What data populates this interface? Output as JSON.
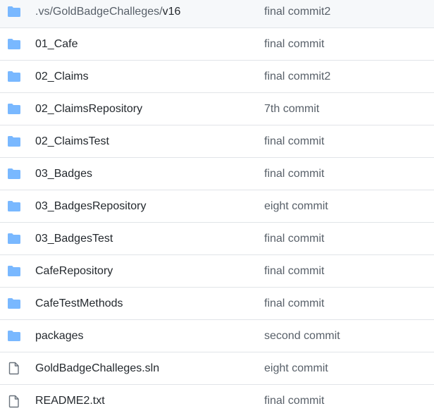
{
  "files": [
    {
      "name_prefix": ".vs/GoldBadgeChalleges/",
      "name": "v16",
      "commit": "final commit2",
      "icon": "folder-icon"
    },
    {
      "name_prefix": "",
      "name": "01_Cafe",
      "commit": "final commit",
      "icon": "folder-icon"
    },
    {
      "name_prefix": "",
      "name": "02_Claims",
      "commit": "final commit2",
      "icon": "folder-icon"
    },
    {
      "name_prefix": "",
      "name": "02_ClaimsRepository",
      "commit": "7th commit",
      "icon": "folder-icon"
    },
    {
      "name_prefix": "",
      "name": "02_ClaimsTest",
      "commit": "final commit",
      "icon": "folder-icon"
    },
    {
      "name_prefix": "",
      "name": "03_Badges",
      "commit": "final commit",
      "icon": "folder-icon"
    },
    {
      "name_prefix": "",
      "name": "03_BadgesRepository",
      "commit": "eight commit",
      "icon": "folder-icon"
    },
    {
      "name_prefix": "",
      "name": "03_BadgesTest",
      "commit": "final commit",
      "icon": "folder-icon"
    },
    {
      "name_prefix": "",
      "name": "CafeRepository",
      "commit": "final commit",
      "icon": "folder-icon"
    },
    {
      "name_prefix": "",
      "name": "CafeTestMethods",
      "commit": "final commit",
      "icon": "folder-icon"
    },
    {
      "name_prefix": "",
      "name": "packages",
      "commit": "second commit",
      "icon": "folder-icon"
    },
    {
      "name_prefix": "",
      "name": "GoldBadgeChalleges.sln",
      "commit": "eight commit",
      "icon": "file-icon"
    },
    {
      "name_prefix": "",
      "name": "README2.txt",
      "commit": "final commit",
      "icon": "file-icon"
    }
  ],
  "colors": {
    "folder": "#79b8ff",
    "file_outline": "#6a737d",
    "text": "#24292e",
    "muted": "#586069",
    "border": "#e1e4e8"
  }
}
